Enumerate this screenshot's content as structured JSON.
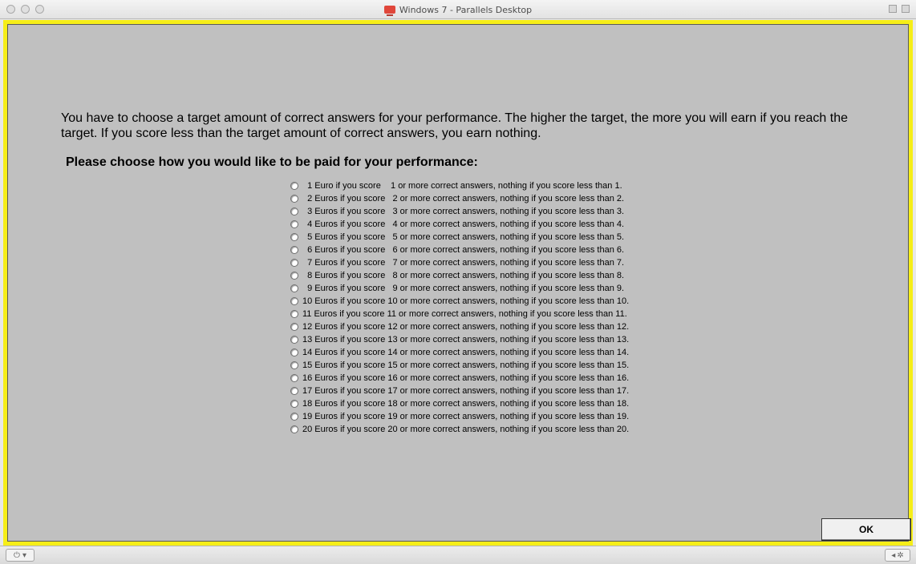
{
  "window": {
    "title": "Windows 7 - Parallels Desktop"
  },
  "intro_text": "You have to choose a target amount of correct answers for your performance. The higher the target, the more you will earn if you reach the target. If you score less than the target amount of correct answers, you earn nothing.",
  "prompt": "Please choose how you would like to be paid for your performance:",
  "options": [
    "  1 Euro if you score    1 or more correct answers, nothing if you score less than 1.",
    "  2 Euros if you score   2 or more correct answers, nothing if you score less than 2.",
    "  3 Euros if you score   3 or more correct answers, nothing if you score less than 3.",
    "  4 Euros if you score   4 or more correct answers, nothing if you score less than 4.",
    "  5 Euros if you score   5 or more correct answers, nothing if you score less than 5.",
    "  6 Euros if you score   6 or more correct answers, nothing if you score less than 6.",
    "  7 Euros if you score   7 or more correct answers, nothing if you score less than 7.",
    "  8 Euros if you score   8 or more correct answers, nothing if you score less than 8.",
    "  9 Euros if you score   9 or more correct answers, nothing if you score less than 9.",
    "10 Euros if you score 10 or more correct answers, nothing if you score less than 10.",
    "11 Euros if you score 11 or more correct answers, nothing if you score less than 11.",
    "12 Euros if you score 12 or more correct answers, nothing if you score less than 12.",
    "13 Euros if you score 13 or more correct answers, nothing if you score less than 13.",
    "14 Euros if you score 14 or more correct answers, nothing if you score less than 14.",
    "15 Euros if you score 15 or more correct answers, nothing if you score less than 15.",
    "16 Euros if you score 16 or more correct answers, nothing if you score less than 16.",
    "17 Euros if you score 17 or more correct answers, nothing if you score less than 17.",
    "18 Euros if you score 18 or more correct answers, nothing if you score less than 18.",
    "19 Euros if you score 19 or more correct answers, nothing if you score less than 19.",
    "20 Euros if you score 20 or more correct answers, nothing if you score less than 20."
  ],
  "ok_label": "OK",
  "icons": {
    "title_icon": "windows-vm-icon",
    "power": "power-icon",
    "settings": "gear-icon"
  },
  "colors": {
    "frame": "#f6ee18",
    "background": "#c0c0c0"
  }
}
